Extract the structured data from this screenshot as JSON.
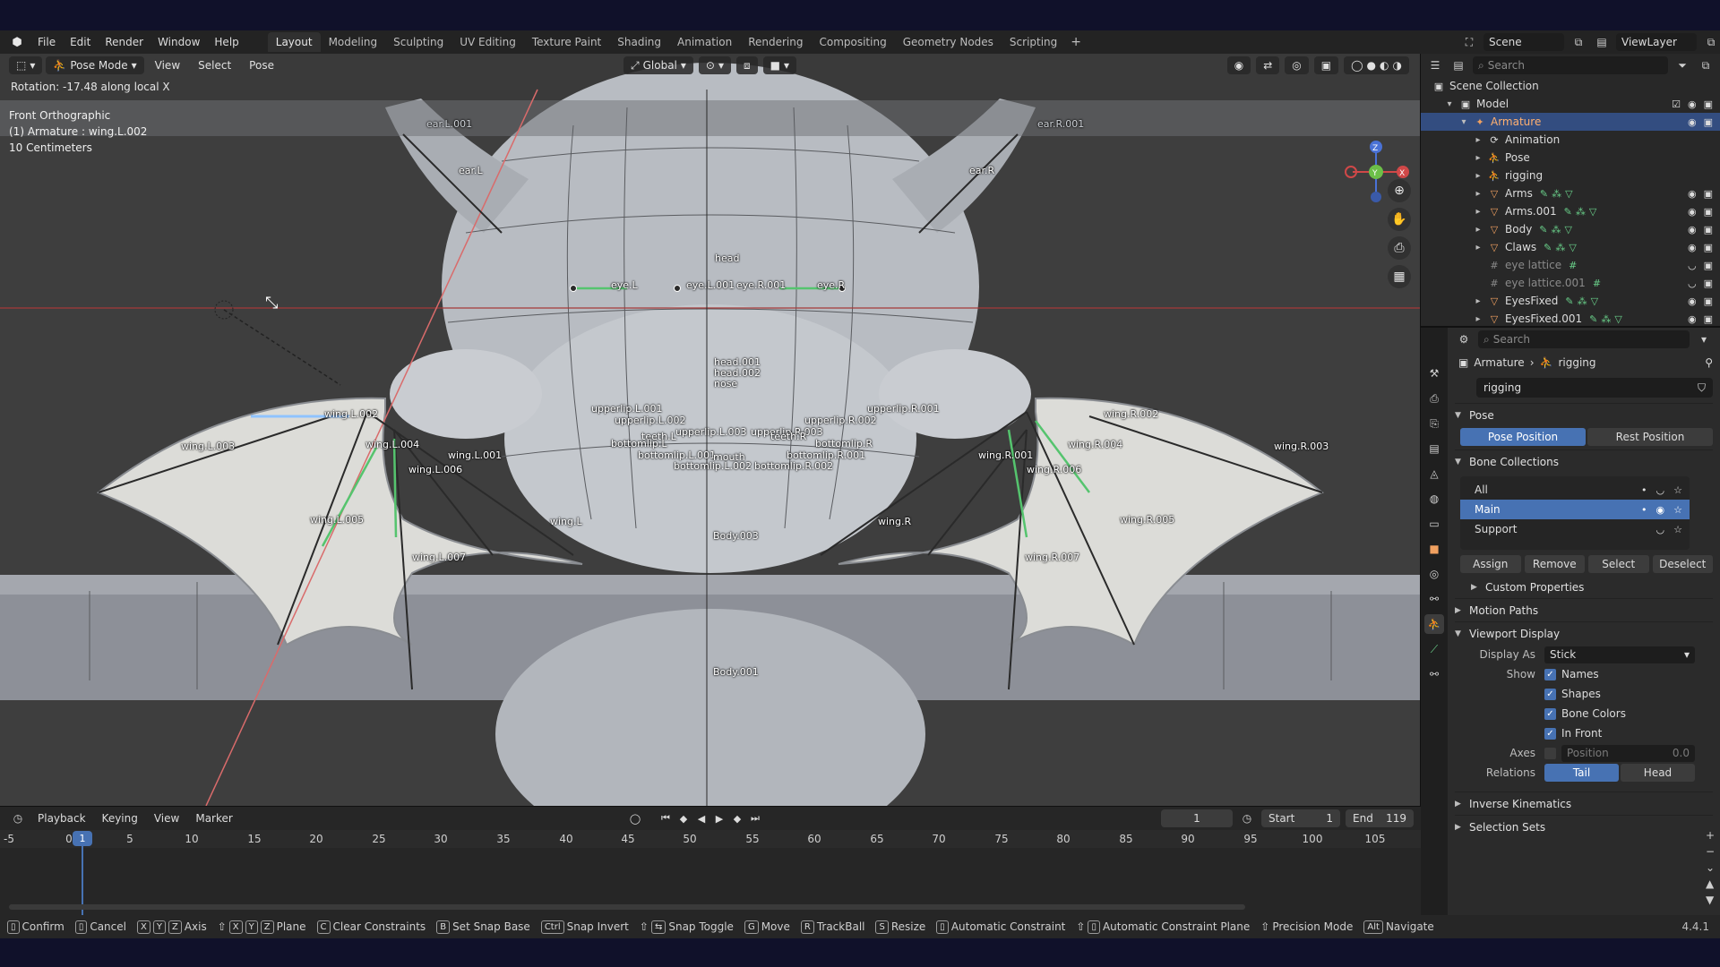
{
  "topbar": {
    "menus": [
      "File",
      "Edit",
      "Render",
      "Window",
      "Help"
    ],
    "workspaces": [
      "Layout",
      "Modeling",
      "Sculpting",
      "UV Editing",
      "Texture Paint",
      "Shading",
      "Animation",
      "Rendering",
      "Compositing",
      "Geometry Nodes",
      "Scripting"
    ],
    "active_workspace": "Layout",
    "add_label": "+",
    "scene": "Scene",
    "view_layer": "ViewLayer"
  },
  "viewport": {
    "mode": "Pose Mode",
    "menus": [
      "View",
      "Select",
      "Pose"
    ],
    "orientation": "Global",
    "operator_status": "Rotation: -17.48 along local X",
    "view_name": "Front Orthographic",
    "active_object": "(1) Armature : wing.L.002",
    "grid_scale": "10 Centimeters",
    "gizmo_axes": {
      "x": "X",
      "y": "Y",
      "z": "Z"
    },
    "bone_labels": {
      "earL": "ear.L",
      "earR": "ear.R",
      "earL001": "ear.L.001",
      "earR001": "ear.R.001",
      "head": "head",
      "eyeL": "eye.L",
      "eyeL001": "eye.L.001",
      "eyeR001": "eye.R.001",
      "eyeR": "eye.R",
      "head001": "head.001",
      "head002": "head.002",
      "nose": "nose",
      "upperlipL001": "upperlip.L.001",
      "upperlipL002": "upperlip.L.002",
      "upperlipL003": "upperlip.L.003",
      "upperlipR001": "upperlip.R.001",
      "upperlipR002": "upperlip.R.002",
      "upperlipR003": "upperlip.R.003",
      "teethL": "teeth.L",
      "teethR": "teeth.R",
      "bottomlipL": "bottomlip.L",
      "bottomlipR": "bottomlip.R",
      "bottomlipL001": "bottomlip.L.001",
      "bottomlipR001": "bottomlip.R.001",
      "bottomlipL002": "bottomlip.L.002",
      "bottomlipR002": "bottomlip.R.002",
      "mouth": "mouth",
      "wingL": "wing.L",
      "wingL001": "wing.L.001",
      "wingL002": "wing.L.002",
      "wingL003": "wing.L.003",
      "wingL004": "wing.L.004",
      "wingL005": "wing.L.005",
      "wingL006": "wing.L.006",
      "wingL007": "wing.L.007",
      "wingR": "wing.R",
      "wingR001": "wing.R.001",
      "wingR002": "wing.R.002",
      "wingR003": "wing.R.003",
      "wingR004": "wing.R.004",
      "wingR005": "wing.R.005",
      "wingR006": "wing.R.006",
      "wingR007": "wing.R.007",
      "body003": "Body.003",
      "body001": "Body.001"
    }
  },
  "timeline": {
    "menus": [
      "Playback",
      "Keying",
      "View",
      "Marker"
    ],
    "current_frame": "1",
    "start_label": "Start",
    "start": "1",
    "end_label": "End",
    "end": "119",
    "ticks": [
      "-5",
      "0",
      "5",
      "10",
      "15",
      "20",
      "25",
      "30",
      "35",
      "40",
      "45",
      "50",
      "55",
      "60",
      "65",
      "70",
      "75",
      "80",
      "85",
      "90",
      "95",
      "100",
      "105"
    ]
  },
  "statusbar": {
    "items": [
      {
        "keys": [],
        "label": "Confirm"
      },
      {
        "keys": [],
        "label": "Cancel"
      },
      {
        "keys": [
          "X",
          "Y",
          "Z"
        ],
        "label": "Axis"
      },
      {
        "keys": [
          "⇧",
          "X",
          "Y",
          "Z"
        ],
        "label": "Plane"
      },
      {
        "keys": [
          "C"
        ],
        "label": "Clear Constraints"
      },
      {
        "keys": [
          "B"
        ],
        "label": "Set Snap Base"
      },
      {
        "keys": [
          "Ctrl"
        ],
        "label": "Snap Invert"
      },
      {
        "keys": [
          "⇧",
          "⇆"
        ],
        "label": "Snap Toggle"
      },
      {
        "keys": [
          "G"
        ],
        "label": "Move"
      },
      {
        "keys": [
          "R"
        ],
        "label": "TrackBall"
      },
      {
        "keys": [
          "S"
        ],
        "label": "Resize"
      },
      {
        "keys": [],
        "label": "Automatic Constraint"
      },
      {
        "keys": [
          "⇧"
        ],
        "label": "Automatic Constraint Plane"
      },
      {
        "keys": [
          "⇧"
        ],
        "label": "Precision Mode"
      },
      {
        "keys": [
          "Alt"
        ],
        "label": "Navigate"
      }
    ],
    "version": "4.4.1"
  },
  "outliner": {
    "search_placeholder": "Search",
    "rows": [
      {
        "name": "Scene Collection",
        "depth": 0,
        "icon": "scene-collection-icon",
        "chev": ""
      },
      {
        "name": "Model",
        "depth": 1,
        "icon": "collection-icon",
        "chev": "▾"
      },
      {
        "name": "Armature",
        "depth": 2,
        "icon": "armature-icon",
        "chev": "▾",
        "selected": true
      },
      {
        "name": "Animation",
        "depth": 3,
        "icon": "action-icon",
        "chev": "▸"
      },
      {
        "name": "Pose",
        "depth": 3,
        "icon": "pose-icon",
        "chev": "▸"
      },
      {
        "name": "rigging",
        "depth": 3,
        "icon": "armature-data-icon",
        "chev": "▸"
      },
      {
        "name": "Arms",
        "depth": 3,
        "icon": "mesh-icon",
        "chev": "▸"
      },
      {
        "name": "Arms.001",
        "depth": 3,
        "icon": "mesh-icon",
        "chev": "▸"
      },
      {
        "name": "Body",
        "depth": 3,
        "icon": "mesh-icon",
        "chev": "▸"
      },
      {
        "name": "Claws",
        "depth": 3,
        "icon": "mesh-icon",
        "chev": "▸"
      },
      {
        "name": "eye lattice",
        "depth": 3,
        "icon": "lattice-icon",
        "chev": "",
        "dim": true
      },
      {
        "name": "eye lattice.001",
        "depth": 3,
        "icon": "lattice-icon",
        "chev": "",
        "dim": true
      },
      {
        "name": "EyesFixed",
        "depth": 3,
        "icon": "mesh-icon",
        "chev": "▸"
      },
      {
        "name": "EyesFixed.001",
        "depth": 3,
        "icon": "mesh-icon",
        "chev": "▸"
      }
    ]
  },
  "properties": {
    "search_placeholder": "Search",
    "breadcrumb": [
      "Armature",
      "rigging"
    ],
    "data_name": "rigging",
    "pose_panel": "Pose",
    "pose_position": "Pose Position",
    "rest_position": "Rest Position",
    "bone_collections_panel": "Bone Collections",
    "collections": [
      {
        "name": "All",
        "selected": false
      },
      {
        "name": "Main",
        "selected": true
      },
      {
        "name": "Support",
        "selected": false
      }
    ],
    "buttons": [
      "Assign",
      "Remove",
      "Select",
      "Deselect"
    ],
    "custom_properties": "Custom Properties",
    "motion_paths": "Motion Paths",
    "viewport_display": "Viewport Display",
    "display_as_label": "Display As",
    "display_as_value": "Stick",
    "show_label": "Show",
    "show_items": [
      {
        "label": "Names",
        "checked": true
      },
      {
        "label": "Shapes",
        "checked": true
      },
      {
        "label": "Bone Colors",
        "checked": true
      },
      {
        "label": "In Front",
        "checked": true
      }
    ],
    "axes_label": "Axes",
    "axes_position_label": "Position",
    "axes_position_value": "0.0",
    "relations_label": "Relations",
    "relations_tail": "Tail",
    "relations_head": "Head",
    "inverse_kinematics": "Inverse Kinematics",
    "selection_sets": "Selection Sets"
  }
}
